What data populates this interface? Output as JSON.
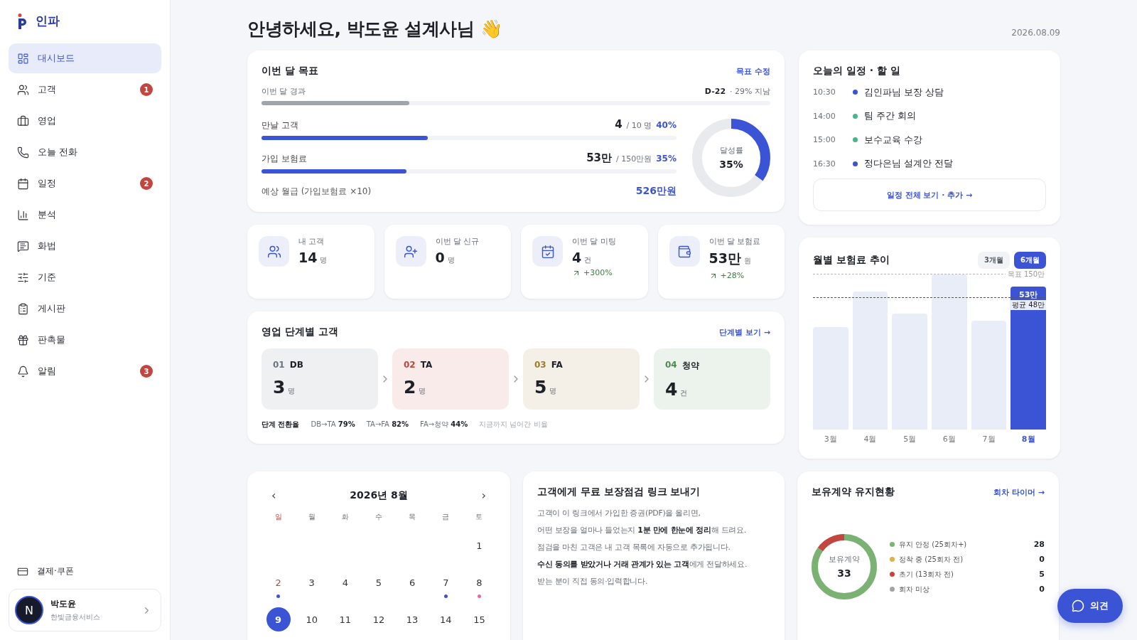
{
  "brand": {
    "name": "인파"
  },
  "sidebar": {
    "items": [
      {
        "kind": "dashboard",
        "label": "대시보드",
        "selected": true
      },
      {
        "kind": "customers",
        "label": "고객",
        "selected": false,
        "badge": "1"
      },
      {
        "kind": "sales",
        "label": "영업",
        "selected": false
      },
      {
        "kind": "call",
        "label": "오늘 전화",
        "selected": false
      },
      {
        "kind": "schedule",
        "label": "일정",
        "selected": false,
        "badge": "2"
      },
      {
        "kind": "analysis",
        "label": "분석",
        "selected": false
      },
      {
        "kind": "script",
        "label": "화법",
        "selected": false
      },
      {
        "kind": "criteria",
        "label": "기준",
        "selected": false
      },
      {
        "kind": "board",
        "label": "게시판",
        "selected": false
      },
      {
        "kind": "promo",
        "label": "판촉물",
        "selected": false
      },
      {
        "kind": "alerts",
        "label": "알림",
        "selected": false,
        "badge": "3"
      }
    ],
    "footer_link": "결제·쿠폰",
    "user": {
      "initial": "N",
      "name": "박도윤",
      "company": "한빛금융서비스"
    }
  },
  "header": {
    "greeting": "안녕하세요, 박도윤 설계사님 👋",
    "date": "2026.08.09"
  },
  "goal": {
    "title": "이번 달 목표",
    "edit_link": "목표 수정",
    "elapsed": {
      "label": "이번 달 경과",
      "dday": "D-22",
      "note": "· 29% 지남",
      "level": 0.29
    },
    "metrics": [
      {
        "label": "만날 고객",
        "value": "4",
        "target": "/ 10 명",
        "percent": "40%",
        "level": 0.4
      },
      {
        "label": "가입 보험료",
        "value": "53만",
        "target": "/ 150만원",
        "percent": "35%",
        "level": 0.35
      }
    ],
    "salary": {
      "label": "예상 월급 (가입보험료 ×10)",
      "value": "526만원"
    },
    "donut": {
      "label": "달성률",
      "value": "35%"
    }
  },
  "today": {
    "title": "오늘의 일정 · 할 일",
    "events": [
      {
        "time": "10:30",
        "title": "김인파님 보장 상담",
        "color": "#3b54d6"
      },
      {
        "time": "14:00",
        "title": "팀 주간 회의",
        "color": "#4cb38a"
      },
      {
        "time": "15:00",
        "title": "보수교육 수강",
        "color": "#4cb38a"
      },
      {
        "time": "16:30",
        "title": "정다은님 설계안 전달",
        "color": "#3b54d6"
      }
    ],
    "button": "일정 전체 보기 · 추가 →"
  },
  "stats": [
    {
      "kind": "customers",
      "label": "내 고객",
      "value": "14",
      "unit": "명"
    },
    {
      "kind": "new",
      "label": "이번 달 신규",
      "value": "0",
      "unit": "명"
    },
    {
      "kind": "meeting",
      "label": "이번 달 미팅",
      "value": "4",
      "unit": "건",
      "change": "+300%"
    },
    {
      "kind": "premium",
      "label": "이번 달 보험료",
      "value": "53만",
      "unit": "원",
      "change": "+28%"
    }
  ],
  "stages": {
    "title": "영업 단계별 고객",
    "link": "단계별 보기 →",
    "items": [
      {
        "num": "01",
        "name": "DB",
        "value": "3",
        "unit": "명",
        "color": "#6b7280"
      },
      {
        "num": "02",
        "name": "TA",
        "value": "2",
        "unit": "명",
        "color": "#c0463f"
      },
      {
        "num": "03",
        "name": "FA",
        "value": "5",
        "unit": "명",
        "color": "#a07a28"
      },
      {
        "num": "04",
        "name": "청약",
        "value": "4",
        "unit": "건",
        "color": "#4f8a4f"
      }
    ],
    "conversion": {
      "label": "단계 전환율",
      "items": [
        {
          "pair": "DB→TA",
          "rate": "79%"
        },
        {
          "pair": "TA→FA",
          "rate": "82%"
        },
        {
          "pair": "FA→청약",
          "rate": "44%"
        }
      ],
      "note": "지금까지 넘어간 비율"
    }
  },
  "trend": {
    "title": "월별 보험료 추이",
    "ranges": [
      {
        "label": "3개월",
        "selected": false
      },
      {
        "label": "6개월",
        "selected": true
      }
    ],
    "target_line": {
      "label": "목표 150만"
    },
    "average_line": {
      "label": "평균 48만"
    },
    "bars": [
      {
        "label": "3월",
        "selected": false
      },
      {
        "label": "4월",
        "selected": false
      },
      {
        "label": "5월",
        "selected": false
      },
      {
        "label": "6월",
        "selected": false
      },
      {
        "label": "7월",
        "selected": false
      },
      {
        "label": "8월",
        "selected": true,
        "value_label": "53만"
      }
    ]
  },
  "calendar": {
    "prev": "‹",
    "next": "›",
    "title": "2026년 8월",
    "weekdays": [
      "일",
      "월",
      "화",
      "수",
      "목",
      "금",
      "토"
    ],
    "weeks": [
      [
        {
          "label": "1",
          "selected": false
        }
      ],
      [
        {
          "label": "2",
          "selected": false,
          "color": "#3b54d6"
        },
        {
          "label": "3",
          "selected": false
        },
        {
          "label": "4",
          "selected": false
        },
        {
          "label": "5",
          "selected": false
        },
        {
          "label": "6",
          "selected": false
        },
        {
          "label": "7",
          "selected": false,
          "color": "#3b54d6"
        },
        {
          "label": "8",
          "selected": false,
          "color": "#e86a9a"
        }
      ],
      [
        {
          "label": "9",
          "selected": true
        },
        {
          "label": "10",
          "selected": false
        },
        {
          "label": "11",
          "selected": false
        },
        {
          "label": "12",
          "selected": false
        },
        {
          "label": "13",
          "selected": false
        },
        {
          "label": "14",
          "selected": false
        },
        {
          "label": "15",
          "selected": false
        }
      ]
    ]
  },
  "share": {
    "title": "고객에게 무료 보장점검 링크 보내기",
    "lines": [
      "고객이 이 링크에서 가입한 증권(PDF)을 올리면,",
      "어떤 보장을 얼마나 들었는지 **1분 만에 한눈에 정리**해 드려요.",
      "점검을 마친 고객은 내 고객 목록에 자동으로 추가됩니다.",
      "**수신 동의를 받았거나 거래 관계가 있는 고객**에게 전달하세요.",
      "받는 분이 직접 동의·입력합니다."
    ]
  },
  "retention": {
    "title": "보유계약 유지현황",
    "link": "회차 타이머 →",
    "center_label": "보유계약",
    "total": "33",
    "items": [
      {
        "label": "유지 안정 (25회차+)",
        "count": "28",
        "color": "#7bb274"
      },
      {
        "label": "정착 중 (25회차 전)",
        "count": "0",
        "color": "#e0b04a"
      },
      {
        "label": "초기 (13회차 전)",
        "count": "5",
        "color": "#c0463f"
      },
      {
        "label": "회차 미상",
        "count": "0",
        "color": "#a3a3a3"
      }
    ]
  },
  "feedback_button": "의견"
}
